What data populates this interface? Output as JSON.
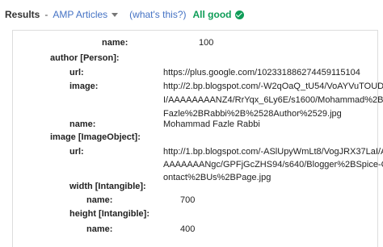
{
  "topbar": {
    "results_label": "Results",
    "separator": "-",
    "dropdown_value": "AMP Articles",
    "help_link": "(what's this?)",
    "status": "All good"
  },
  "icons": {
    "dropdown": "chevron-down-icon",
    "status": "check-circle-icon"
  },
  "colors": {
    "link": "#4472c4",
    "status_ok": "#0f9d58"
  },
  "rows": [
    {
      "key": "name:",
      "value": "100"
    },
    {
      "key": "author [Person]:"
    },
    {
      "key": "url:",
      "value": "https://plus.google.com/102331886274459115104"
    },
    {
      "key": "image:",
      "value": [
        "http://2.bp.blogspot.com/-W2qOaQ_tU54/VoAYVuTOUD",
        "I/AAAAAAAANZ4/RrYqx_6Ly6E/s1600/Mohammad%2B",
        "Fazle%2BRabbi%2B%2528Author%2529.jpg"
      ]
    },
    {
      "key": "name:",
      "value": "Mohammad Fazle Rabbi"
    },
    {
      "key": "image [ImageObject]:"
    },
    {
      "key": "url:",
      "value": [
        "http://1.bp.blogspot.com/-ASlUpyWmLt8/VogJRX37LaI/A",
        "AAAAAAANgc/GPFjGcZHS94/s640/Blogger%2BSpice-C",
        "ontact%2BUs%2BPage.jpg"
      ]
    },
    {
      "key": "width [Intangible]:"
    },
    {
      "key": "name:",
      "value": "700"
    },
    {
      "key": "height [Intangible]:"
    },
    {
      "key": "name:",
      "value": "400"
    }
  ]
}
